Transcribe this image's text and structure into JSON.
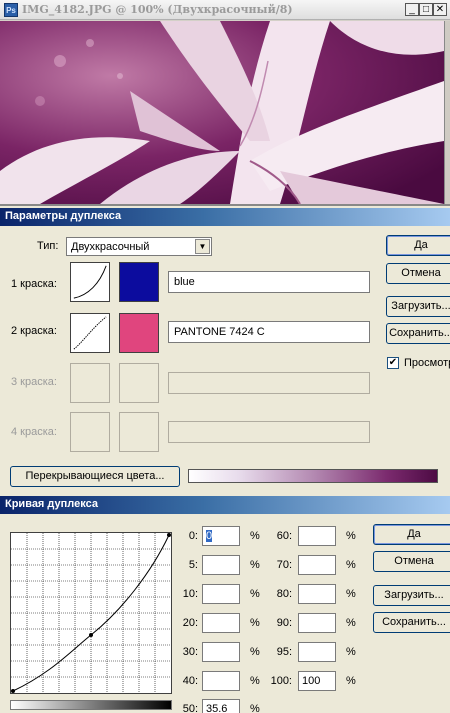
{
  "image_window": {
    "title": "IMG_4182.JPG @ 100% (Двухкрасочный/8)",
    "app_icon": "Ps",
    "buttons": {
      "minimize": "_",
      "maximize": "□",
      "close": "✕"
    }
  },
  "duplex_options": {
    "title": "Параметры дуплекса",
    "type_label": "Тип:",
    "type_value": "Двухкрасочный",
    "inks": [
      {
        "label": "1 краска:",
        "name": "blue",
        "color": "#0c0c9e",
        "enabled": true
      },
      {
        "label": "2 краска:",
        "name": "PANTONE 7424 C",
        "color": "#e0457e",
        "enabled": true
      },
      {
        "label": "3 краска:",
        "name": "",
        "color": "",
        "enabled": false
      },
      {
        "label": "4 краска:",
        "name": "",
        "color": "",
        "enabled": false
      }
    ],
    "buttons": {
      "ok": "Да",
      "cancel": "Отмена",
      "load": "Загрузить...",
      "save": "Сохранить..."
    },
    "preview_label": "Просмотр",
    "preview_checked": true,
    "overprint_button": "Перекрывающиеся цвета...",
    "accent_color": "#0a246a"
  },
  "duplex_curve": {
    "title": "Кривая дуплекса",
    "points": [
      {
        "label": "0:",
        "value": "0"
      },
      {
        "label": "5:",
        "value": ""
      },
      {
        "label": "10:",
        "value": ""
      },
      {
        "label": "20:",
        "value": ""
      },
      {
        "label": "30:",
        "value": ""
      },
      {
        "label": "40:",
        "value": ""
      },
      {
        "label": "50:",
        "value": "35.6"
      },
      {
        "label": "60:",
        "value": ""
      },
      {
        "label": "70:",
        "value": ""
      },
      {
        "label": "80:",
        "value": ""
      },
      {
        "label": "90:",
        "value": ""
      },
      {
        "label": "95:",
        "value": ""
      },
      {
        "label": "100:",
        "value": "100"
      }
    ],
    "percent": "%",
    "buttons": {
      "ok": "Да",
      "cancel": "Отмена",
      "load": "Загрузить...",
      "save": "Сохранить..."
    }
  }
}
